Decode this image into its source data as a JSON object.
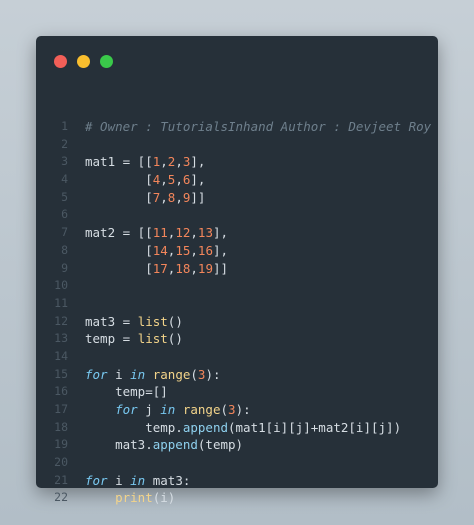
{
  "window": {
    "buttons": [
      {
        "name": "close",
        "color": "#f25f58"
      },
      {
        "name": "minimize",
        "color": "#f9be2e"
      },
      {
        "name": "zoom",
        "color": "#3ac94a"
      }
    ]
  },
  "theme": {
    "background": "#263039",
    "comment": "#6e7f8c",
    "number": "#f3865b",
    "keyword": "#78c8f0",
    "function": "#f3d48a",
    "method": "#8ed0ee",
    "text": "#d6dde3",
    "line_number": "#4b5863"
  },
  "code": {
    "lines": [
      {
        "n": "1",
        "tokens": [
          [
            "comment",
            "# Owner : TutorialsInhand Author : Devjeet Roy"
          ]
        ]
      },
      {
        "n": "2",
        "tokens": []
      },
      {
        "n": "3",
        "tokens": [
          [
            "plain",
            "mat1 = [["
          ],
          [
            "number",
            "1"
          ],
          [
            "plain",
            ","
          ],
          [
            "number",
            "2"
          ],
          [
            "plain",
            ","
          ],
          [
            "number",
            "3"
          ],
          [
            "plain",
            "],"
          ]
        ]
      },
      {
        "n": "4",
        "tokens": [
          [
            "plain",
            "        ["
          ],
          [
            "number",
            "4"
          ],
          [
            "plain",
            ","
          ],
          [
            "number",
            "5"
          ],
          [
            "plain",
            ","
          ],
          [
            "number",
            "6"
          ],
          [
            "plain",
            "],"
          ]
        ]
      },
      {
        "n": "5",
        "tokens": [
          [
            "plain",
            "        ["
          ],
          [
            "number",
            "7"
          ],
          [
            "plain",
            ","
          ],
          [
            "number",
            "8"
          ],
          [
            "plain",
            ","
          ],
          [
            "number",
            "9"
          ],
          [
            "plain",
            "]]"
          ]
        ]
      },
      {
        "n": "6",
        "tokens": []
      },
      {
        "n": "7",
        "tokens": [
          [
            "plain",
            "mat2 = [["
          ],
          [
            "number",
            "11"
          ],
          [
            "plain",
            ","
          ],
          [
            "number",
            "12"
          ],
          [
            "plain",
            ","
          ],
          [
            "number",
            "13"
          ],
          [
            "plain",
            "],"
          ]
        ]
      },
      {
        "n": "8",
        "tokens": [
          [
            "plain",
            "        ["
          ],
          [
            "number",
            "14"
          ],
          [
            "plain",
            ","
          ],
          [
            "number",
            "15"
          ],
          [
            "plain",
            ","
          ],
          [
            "number",
            "16"
          ],
          [
            "plain",
            "],"
          ]
        ]
      },
      {
        "n": "9",
        "tokens": [
          [
            "plain",
            "        ["
          ],
          [
            "number",
            "17"
          ],
          [
            "plain",
            ","
          ],
          [
            "number",
            "18"
          ],
          [
            "plain",
            ","
          ],
          [
            "number",
            "19"
          ],
          [
            "plain",
            "]]"
          ]
        ]
      },
      {
        "n": "10",
        "tokens": []
      },
      {
        "n": "11",
        "tokens": []
      },
      {
        "n": "12",
        "tokens": [
          [
            "plain",
            "mat3 = "
          ],
          [
            "func",
            "list"
          ],
          [
            "plain",
            "()"
          ]
        ]
      },
      {
        "n": "13",
        "tokens": [
          [
            "plain",
            "temp = "
          ],
          [
            "func",
            "list"
          ],
          [
            "plain",
            "()"
          ]
        ]
      },
      {
        "n": "14",
        "tokens": []
      },
      {
        "n": "15",
        "tokens": [
          [
            "keyword",
            "for"
          ],
          [
            "plain",
            " i "
          ],
          [
            "keyword",
            "in"
          ],
          [
            "plain",
            " "
          ],
          [
            "func",
            "range"
          ],
          [
            "plain",
            "("
          ],
          [
            "number",
            "3"
          ],
          [
            "plain",
            "):"
          ]
        ]
      },
      {
        "n": "16",
        "tokens": [
          [
            "plain",
            "    temp=[]"
          ]
        ]
      },
      {
        "n": "17",
        "tokens": [
          [
            "plain",
            "    "
          ],
          [
            "keyword",
            "for"
          ],
          [
            "plain",
            " j "
          ],
          [
            "keyword",
            "in"
          ],
          [
            "plain",
            " "
          ],
          [
            "func",
            "range"
          ],
          [
            "plain",
            "("
          ],
          [
            "number",
            "3"
          ],
          [
            "plain",
            "):"
          ]
        ]
      },
      {
        "n": "18",
        "tokens": [
          [
            "plain",
            "        temp."
          ],
          [
            "method",
            "append"
          ],
          [
            "plain",
            "(mat1[i][j]+mat2[i][j])"
          ]
        ]
      },
      {
        "n": "19",
        "tokens": [
          [
            "plain",
            "    mat3."
          ],
          [
            "method",
            "append"
          ],
          [
            "plain",
            "(temp)"
          ]
        ]
      },
      {
        "n": "20",
        "tokens": []
      },
      {
        "n": "21",
        "tokens": [
          [
            "keyword",
            "for"
          ],
          [
            "plain",
            " i "
          ],
          [
            "keyword",
            "in"
          ],
          [
            "plain",
            " mat3:"
          ]
        ]
      },
      {
        "n": "22",
        "tokens": [
          [
            "plain",
            "    "
          ],
          [
            "func",
            "print"
          ],
          [
            "plain",
            "(i)"
          ]
        ]
      }
    ]
  }
}
